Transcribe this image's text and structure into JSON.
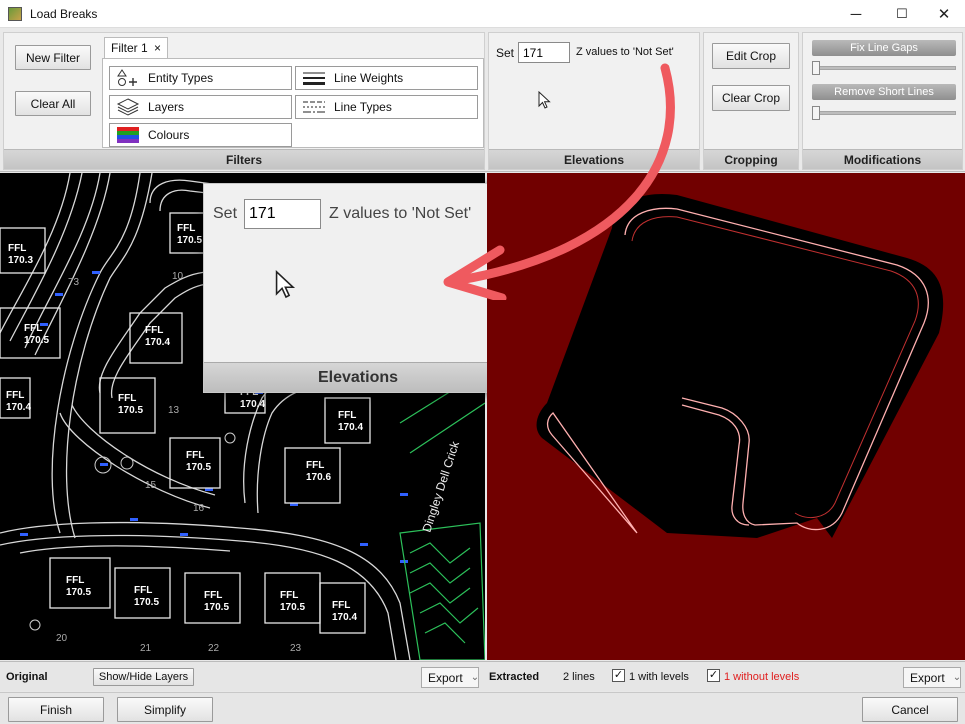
{
  "window": {
    "title": "Load Breaks",
    "minimize": "─",
    "maximize": "☐",
    "close": "✕"
  },
  "filters": {
    "new_filter": "New Filter",
    "clear_all": "Clear All",
    "tab_label": "Filter 1",
    "tab_close": "×",
    "items": {
      "entity_types": "Entity Types",
      "line_weights": "Line Weights",
      "layers": "Layers",
      "line_types": "Line Types",
      "colours": "Colours"
    },
    "footer": "Filters"
  },
  "elevations": {
    "set_label": "Set",
    "value": "171",
    "suffix": "Z values to 'Not Set'",
    "footer": "Elevations"
  },
  "cropping": {
    "edit_crop": "Edit Crop",
    "clear_crop": "Clear Crop",
    "footer": "Cropping"
  },
  "modifications": {
    "fix_line_gaps": "Fix Line Gaps",
    "remove_short_lines": "Remove Short Lines",
    "fix_line_gaps_level": 0,
    "remove_short_lines_level": 0,
    "footer": "Modifications"
  },
  "zoom_overlay": {
    "set_label": "Set",
    "value": "171",
    "suffix": "Z values to 'Not Set'",
    "footer": "Elevations"
  },
  "cad_labels": {
    "plots": [
      {
        "ffl": "FFL",
        "level": "170.3"
      },
      {
        "ffl": "FFL",
        "level": "170.5"
      },
      {
        "ffl": "FFL",
        "level": "170.4"
      },
      {
        "ffl": "FFL",
        "level": "170.5"
      },
      {
        "ffl": "FFL",
        "level": "170.4"
      },
      {
        "ffl": "FFL",
        "level": "170.5"
      },
      {
        "ffl": "FFL",
        "level": "170.5"
      },
      {
        "ffl": "FFL",
        "level": "170.4"
      },
      {
        "ffl": "FFL",
        "level": "170.4"
      },
      {
        "ffl": "FFL",
        "level": "170.6"
      },
      {
        "ffl": "FFL",
        "level": "170.5"
      },
      {
        "ffl": "FFL",
        "level": "170.5"
      },
      {
        "ffl": "FFL",
        "level": "170.5"
      },
      {
        "ffl": "FFL",
        "level": "170.5"
      },
      {
        "ffl": "FFL",
        "level": "170.4"
      }
    ],
    "plot_numbers": [
      "73",
      "10",
      "13",
      "15",
      "16",
      "20",
      "21",
      "22",
      "23"
    ],
    "street": "Dingley Dell Crick"
  },
  "status": {
    "original_label": "Original",
    "show_hide_layers": "Show/Hide Layers",
    "export_left": "Export",
    "extracted_label": "Extracted",
    "line_count": "2 lines",
    "with_levels": "1 with levels",
    "without_levels": "1 without levels",
    "with_levels_checked": "✓",
    "without_levels_checked": "✓",
    "export_right": "Export",
    "dropdown_arrow": "⌄"
  },
  "actions": {
    "finish": "Finish",
    "simplify": "Simplify",
    "cancel": "Cancel"
  },
  "colors": {
    "extract_bg": "#710000",
    "annotation_arrow": "#ef5a5f",
    "warning_text": "#e02020"
  }
}
